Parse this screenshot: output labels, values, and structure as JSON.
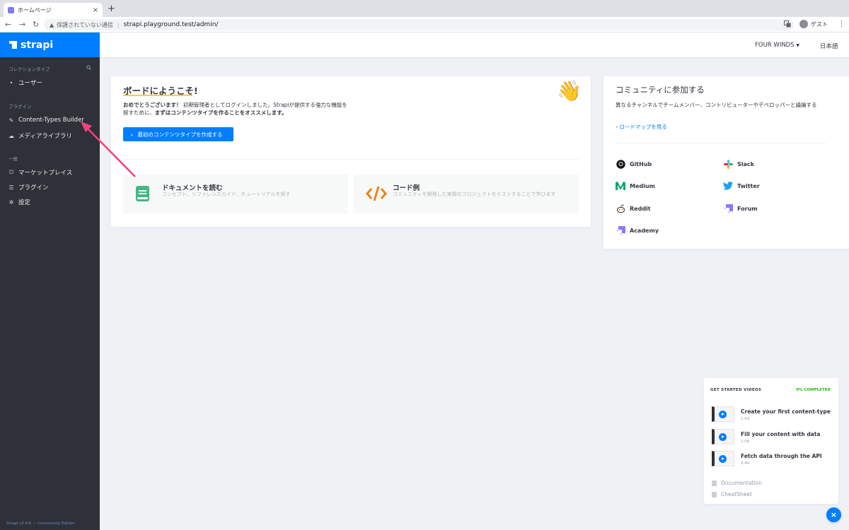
{
  "browser": {
    "tab_title": "ホームページ",
    "tab_close": "×",
    "new_tab": "+",
    "security_label": "保護されていない通信",
    "url": "strapi.playground.test/admin/",
    "profile_label": "ゲスト",
    "back": "←",
    "forward": "→",
    "reload": "↻",
    "warn": "▲",
    "menu": "⋮"
  },
  "sidebar": {
    "brand": "strapi",
    "collections_heading": "コレクションタイプ",
    "collections": [
      {
        "label": "ユーザー"
      }
    ],
    "plugins_heading": "プラグイン",
    "plugins": [
      {
        "label": "Content-Types Builder"
      },
      {
        "label": "メディアライブラリ"
      }
    ],
    "general_heading": "一般",
    "general": [
      {
        "label": "マーケットプレイス"
      },
      {
        "label": "プラグイン"
      },
      {
        "label": "設定"
      }
    ],
    "footer": "Strapi v3.4.6 — Community Edition"
  },
  "header": {
    "org": "FOUR WINDS",
    "language": "日本語"
  },
  "welcome": {
    "title": "ボードにようこそ!",
    "text_bold": "おめでとうございます！",
    "text_body": " 初期管理者としてログインしました。Strapiが提供する強力な機能を探すために、",
    "text_bold2": "まずはコンテンツタイプを作ることをオススメします。",
    "cta": "最初のコンテンツタイプを作成する",
    "tiles": [
      {
        "title": "ドキュメントを読む",
        "subtitle": "コンセプト、リファレンスガイド、チュートリアルを探す"
      },
      {
        "title": "コード例",
        "subtitle": "コミュニティを開発した実際のプロジェクトをテストすることで学びます"
      }
    ]
  },
  "community": {
    "title": "コミュニティに参加する",
    "text": "異なるチャンネルでチームメンバー、コントリビューターやデベロッパーと議論する",
    "roadmap_link": "ロードマップを見る",
    "links": [
      {
        "label": "GitHub",
        "icon": "github-icon"
      },
      {
        "label": "Slack",
        "icon": "slack-icon"
      },
      {
        "label": "Medium",
        "icon": "medium-icon"
      },
      {
        "label": "Twitter",
        "icon": "twitter-icon"
      },
      {
        "label": "Reddit",
        "icon": "reddit-icon"
      },
      {
        "label": "Forum",
        "icon": "forum-icon"
      },
      {
        "label": "Academy",
        "icon": "academy-icon"
      }
    ]
  },
  "videos": {
    "heading": "GET STARTED VIDEOS",
    "completed": "0% COMPLETED",
    "items": [
      {
        "title": "Create your first content-type",
        "duration": "1:43"
      },
      {
        "title": "Fill your content with data",
        "duration": "1:06"
      },
      {
        "title": "Fetch data through the API",
        "duration": "0:44"
      }
    ],
    "links": [
      {
        "label": "Documentation"
      },
      {
        "label": "CheatSheet"
      }
    ],
    "close": "×"
  },
  "colors": {
    "accent": "#007eff",
    "sidebar_bg": "#2e3138",
    "success": "#27b70f",
    "annotation_arrow": "#f5427b"
  }
}
